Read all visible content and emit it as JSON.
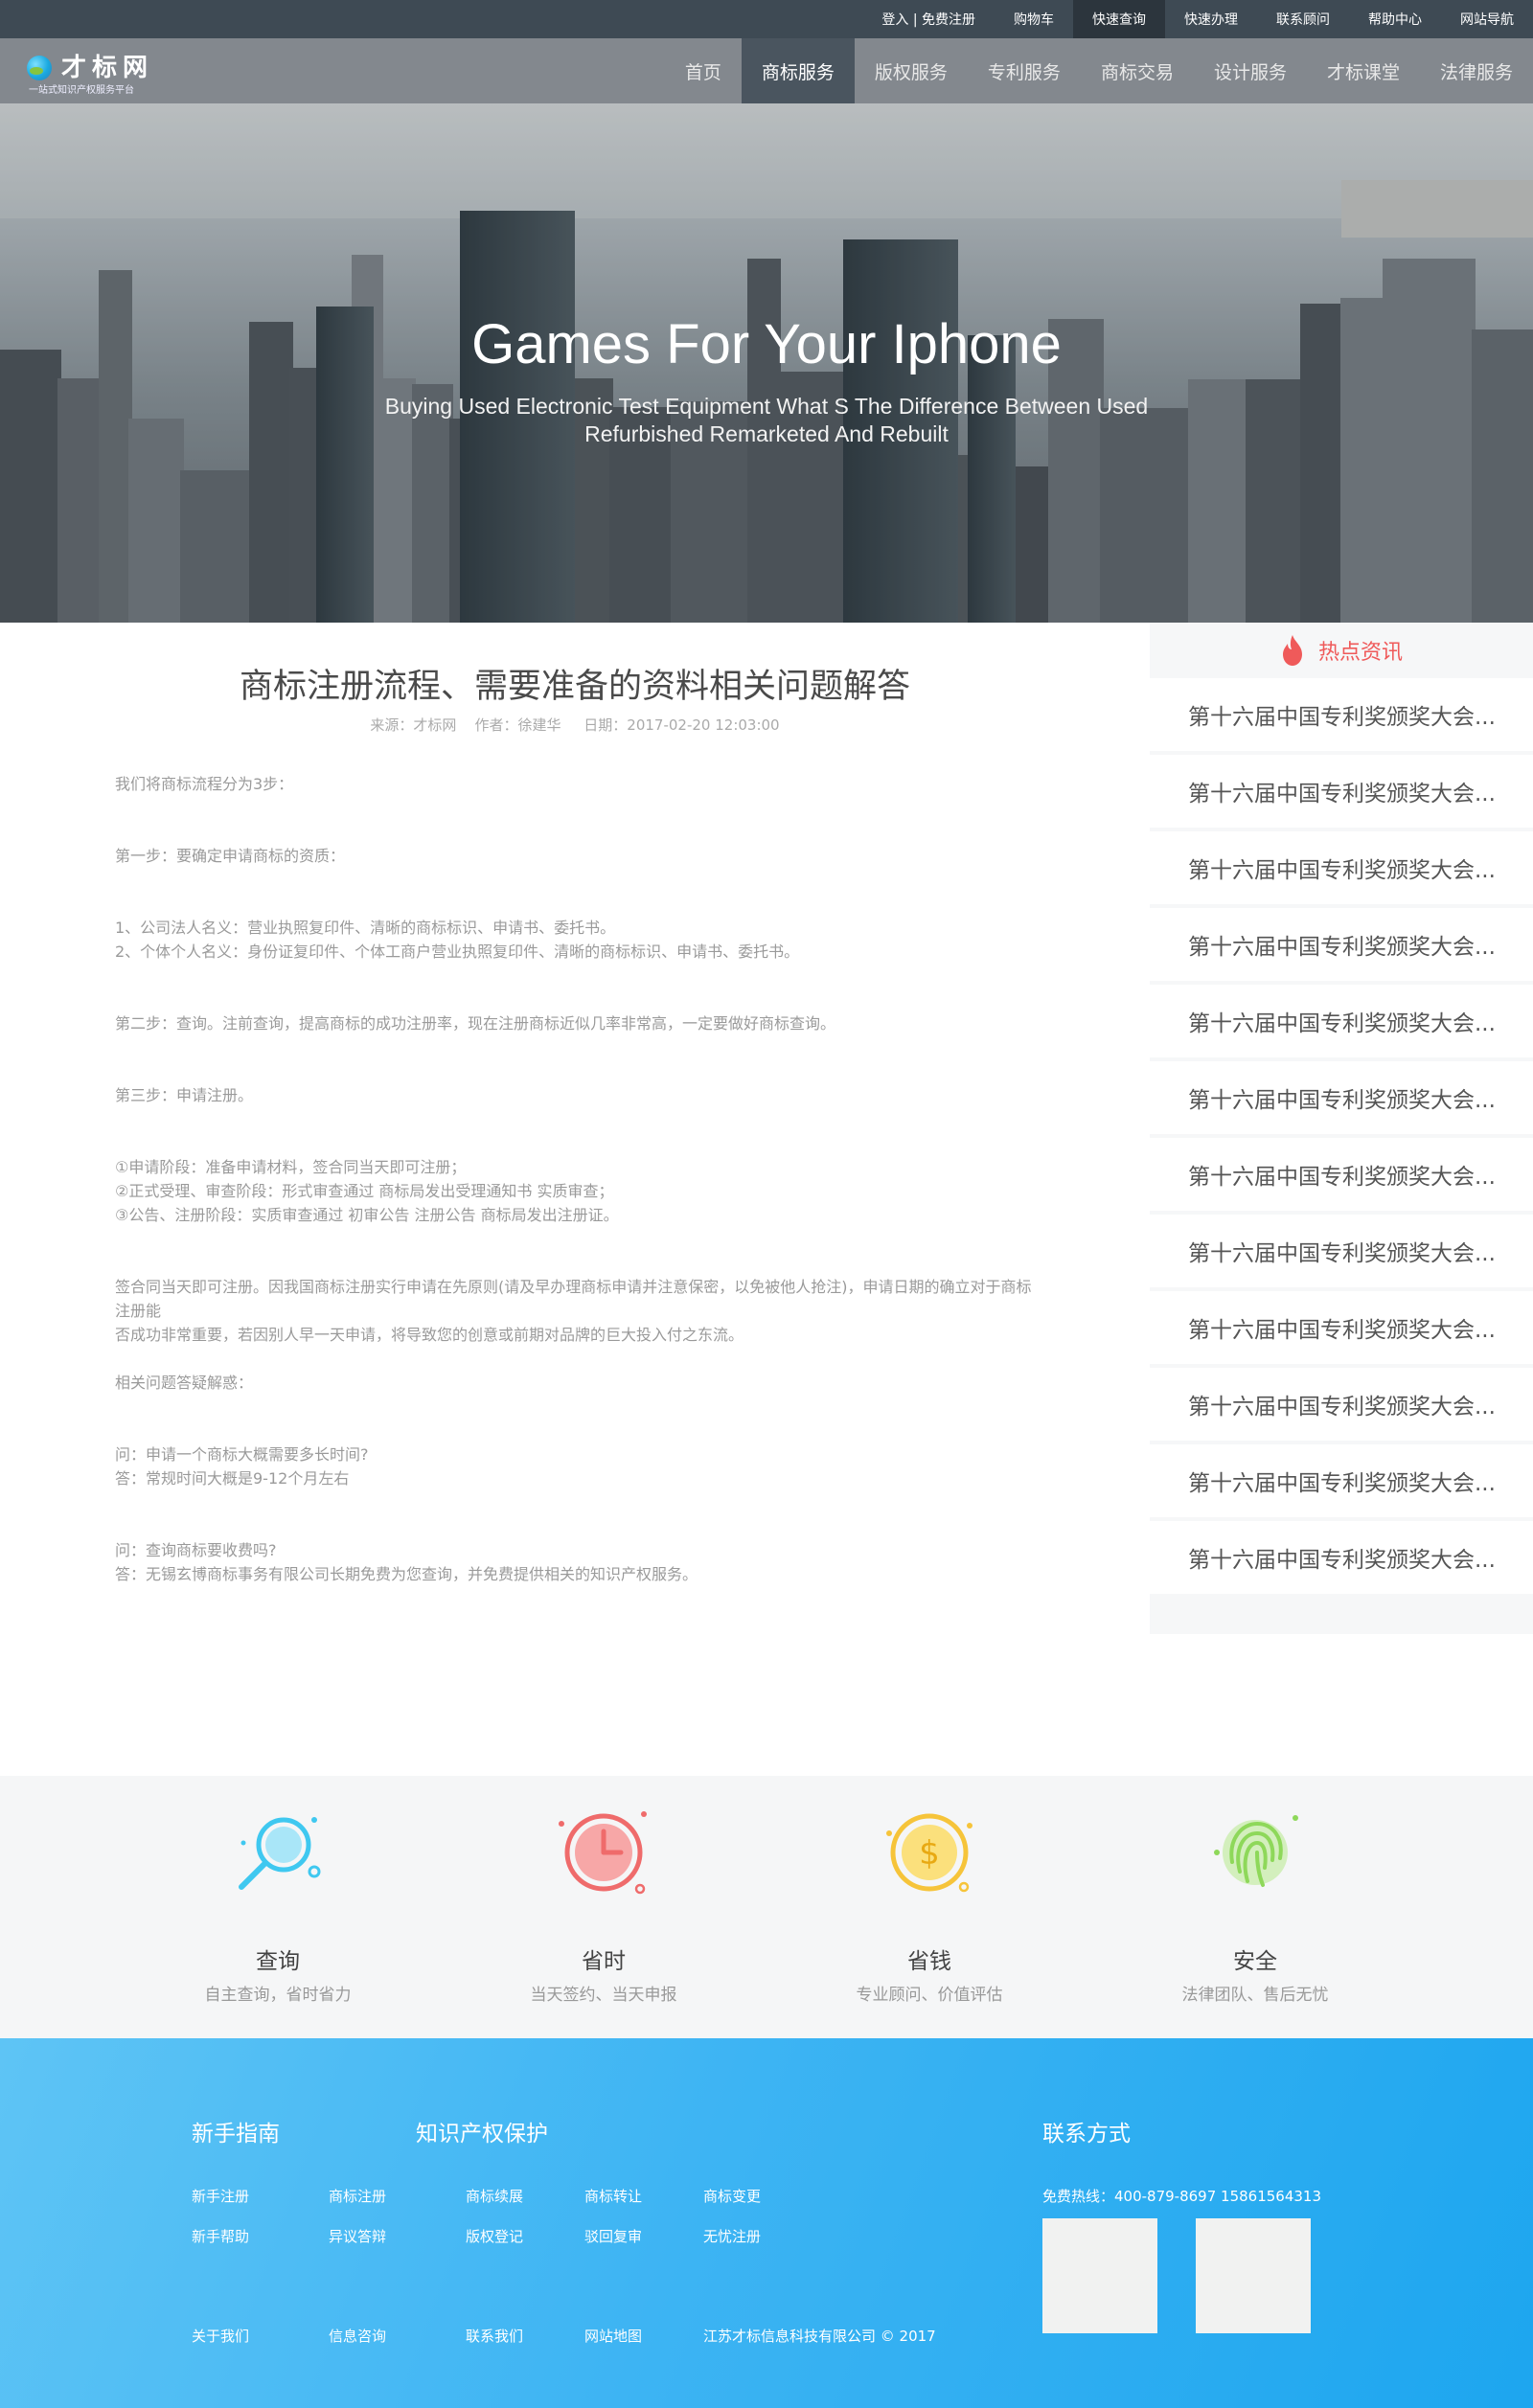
{
  "topbar": {
    "links": [
      "登入 | 免费注册",
      "购物车",
      "快速查询",
      "快速办理",
      "联系顾问",
      "帮助中心",
      "网站导航"
    ]
  },
  "logo": {
    "name": "才标网",
    "slogan": "一站式知识产权服务平台"
  },
  "nav": {
    "items": [
      "首页",
      "商标服务",
      "版权服务",
      "专利服务",
      "商标交易",
      "设计服务",
      "才标课堂",
      "法律服务"
    ],
    "active": "商标服务"
  },
  "hero": {
    "title": "Games For Your Iphone",
    "subtitle": "Buying Used Electronic Test Equipment What S The Difference Between Used Refurbished Remarketed And Rebuilt"
  },
  "article": {
    "title": "商标注册流程、需要准备的资料相关问题解答",
    "meta": "来源：才标网    作者：徐建华     日期：2017-02-20 12:03:00",
    "paragraphs": [
      "我们将商标流程分为3步：",
      "第一步：要确定申请商标的资质：",
      "1、公司法人名义：营业执照复印件、清晰的商标标识、申请书、委托书。\n2、个体个人名义：身份证复印件、个体工商户营业执照复印件、清晰的商标标识、申请书、委托书。",
      "第二步：查询。注前查询，提高商标的成功注册率，现在注册商标近似几率非常高，一定要做好商标查询。",
      "第三步：申请注册。",
      "①申请阶段：准备申请材料，签合同当天即可注册；\n②正式受理、审查阶段：形式审查通过 商标局发出受理通知书 实质审查；\n③公告、注册阶段：实质审查通过 初审公告 注册公告 商标局发出注册证。",
      "签合同当天即可注册。因我国商标注册实行申请在先原则(请及早办理商标申请并注意保密，以免被他人抢注)，申请日期的确立对于商标注册能\n否成功非常重要，若因别人早一天申请，将导致您的创意或前期对品牌的巨大投入付之东流。",
      "相关问题答疑解惑：",
      "问：申请一个商标大概需要多长时间?\n答：常规时间大概是9-12个月左右",
      "问：查询商标要收费吗?\n答：无锡玄博商标事务有限公司长期免费为您查询，并免费提供相关的知识产权服务。"
    ]
  },
  "sidebar": {
    "heading": "热点资讯",
    "items": [
      "第十六届中国专利奖颁奖大会...",
      "第十六届中国专利奖颁奖大会...",
      "第十六届中国专利奖颁奖大会...",
      "第十六届中国专利奖颁奖大会...",
      "第十六届中国专利奖颁奖大会...",
      "第十六届中国专利奖颁奖大会...",
      "第十六届中国专利奖颁奖大会...",
      "第十六届中国专利奖颁奖大会...",
      "第十六届中国专利奖颁奖大会...",
      "第十六届中国专利奖颁奖大会...",
      "第十六届中国专利奖颁奖大会...",
      "第十六届中国专利奖颁奖大会..."
    ]
  },
  "features": [
    {
      "title": "查询",
      "desc": "自主查询，省时省力",
      "icon": "magnifier-icon",
      "color": "#3fc8f0"
    },
    {
      "title": "省时",
      "desc": "当天签约、当天申报",
      "icon": "clock-icon",
      "color": "#ef6b6b"
    },
    {
      "title": "省钱",
      "desc": "专业顾问、价值评估",
      "icon": "coin-icon",
      "color": "#f6c43a"
    },
    {
      "title": "安全",
      "desc": "法律团队、售后无忧",
      "icon": "fingerprint-icon",
      "color": "#8ed85a"
    }
  ],
  "footer": {
    "guide": {
      "heading": "新手指南",
      "links": [
        "新手注册",
        "新手帮助"
      ]
    },
    "ip": {
      "heading": "知识产权保护",
      "links": [
        "商标注册",
        "商标续展",
        "商标转让",
        "商标变更",
        "异议答辩",
        "版权登记",
        "驳回复审",
        "无忧注册"
      ]
    },
    "contact": {
      "heading": "联系方式",
      "hotline": "免费热线：400-879-8697     15861564313"
    },
    "bottom_links": [
      "关于我们",
      "信息咨询",
      "联系我们",
      "网站地图"
    ],
    "copyright": "江苏才标信息科技有限公司 © 2017"
  }
}
